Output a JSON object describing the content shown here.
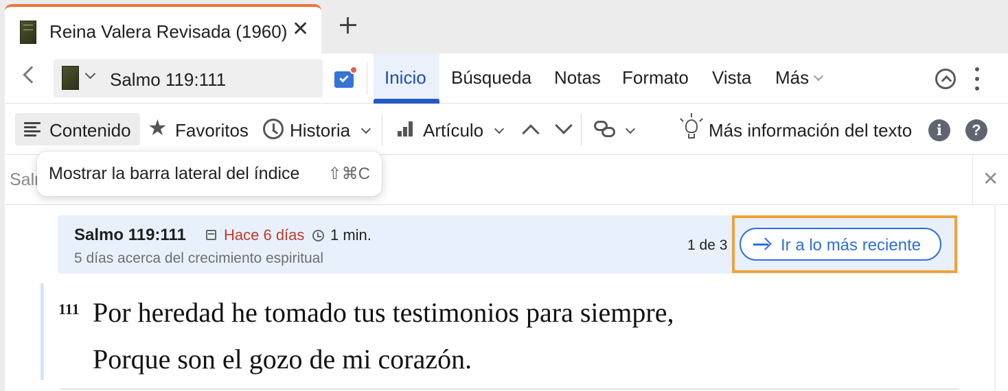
{
  "tab": {
    "title": "Reina Valera Revisada (1960)",
    "close_icon": "close-icon",
    "new_tab_icon": "plus-icon",
    "accent_color": "#ea7439"
  },
  "nav": {
    "reference": "Salmo 119:111",
    "menu": [
      "Inicio",
      "Búsqueda",
      "Notas",
      "Formato",
      "Vista",
      "Más"
    ],
    "active_menu": "Inicio",
    "active_color": "#2459c6"
  },
  "toolbar": {
    "contenido": "Contenido",
    "favoritos": "Favoritos",
    "historia": "Historia",
    "articulo": "Artículo",
    "mas_info": "Más información del texto"
  },
  "search": {
    "placeholder": "Salmo 119:111"
  },
  "tooltip": {
    "text": "Mostrar la barra lateral del índice",
    "shortcut": "⇧⌘C"
  },
  "banner": {
    "reference": "Salmo 119:111",
    "ago": "Hace 6 días",
    "duration": "1 min.",
    "subtitle": "5 días acerca del crecimiento espiritual",
    "count": "1 de 3",
    "button": "Ir a lo más reciente",
    "button_color": "#2d6fdc",
    "highlight_color": "#f0a23a"
  },
  "verse": {
    "number": "111",
    "line1": "Por heredad he tomado tus testimonios para siempre,",
    "line2": "Porque son el gozo de mi corazón."
  }
}
